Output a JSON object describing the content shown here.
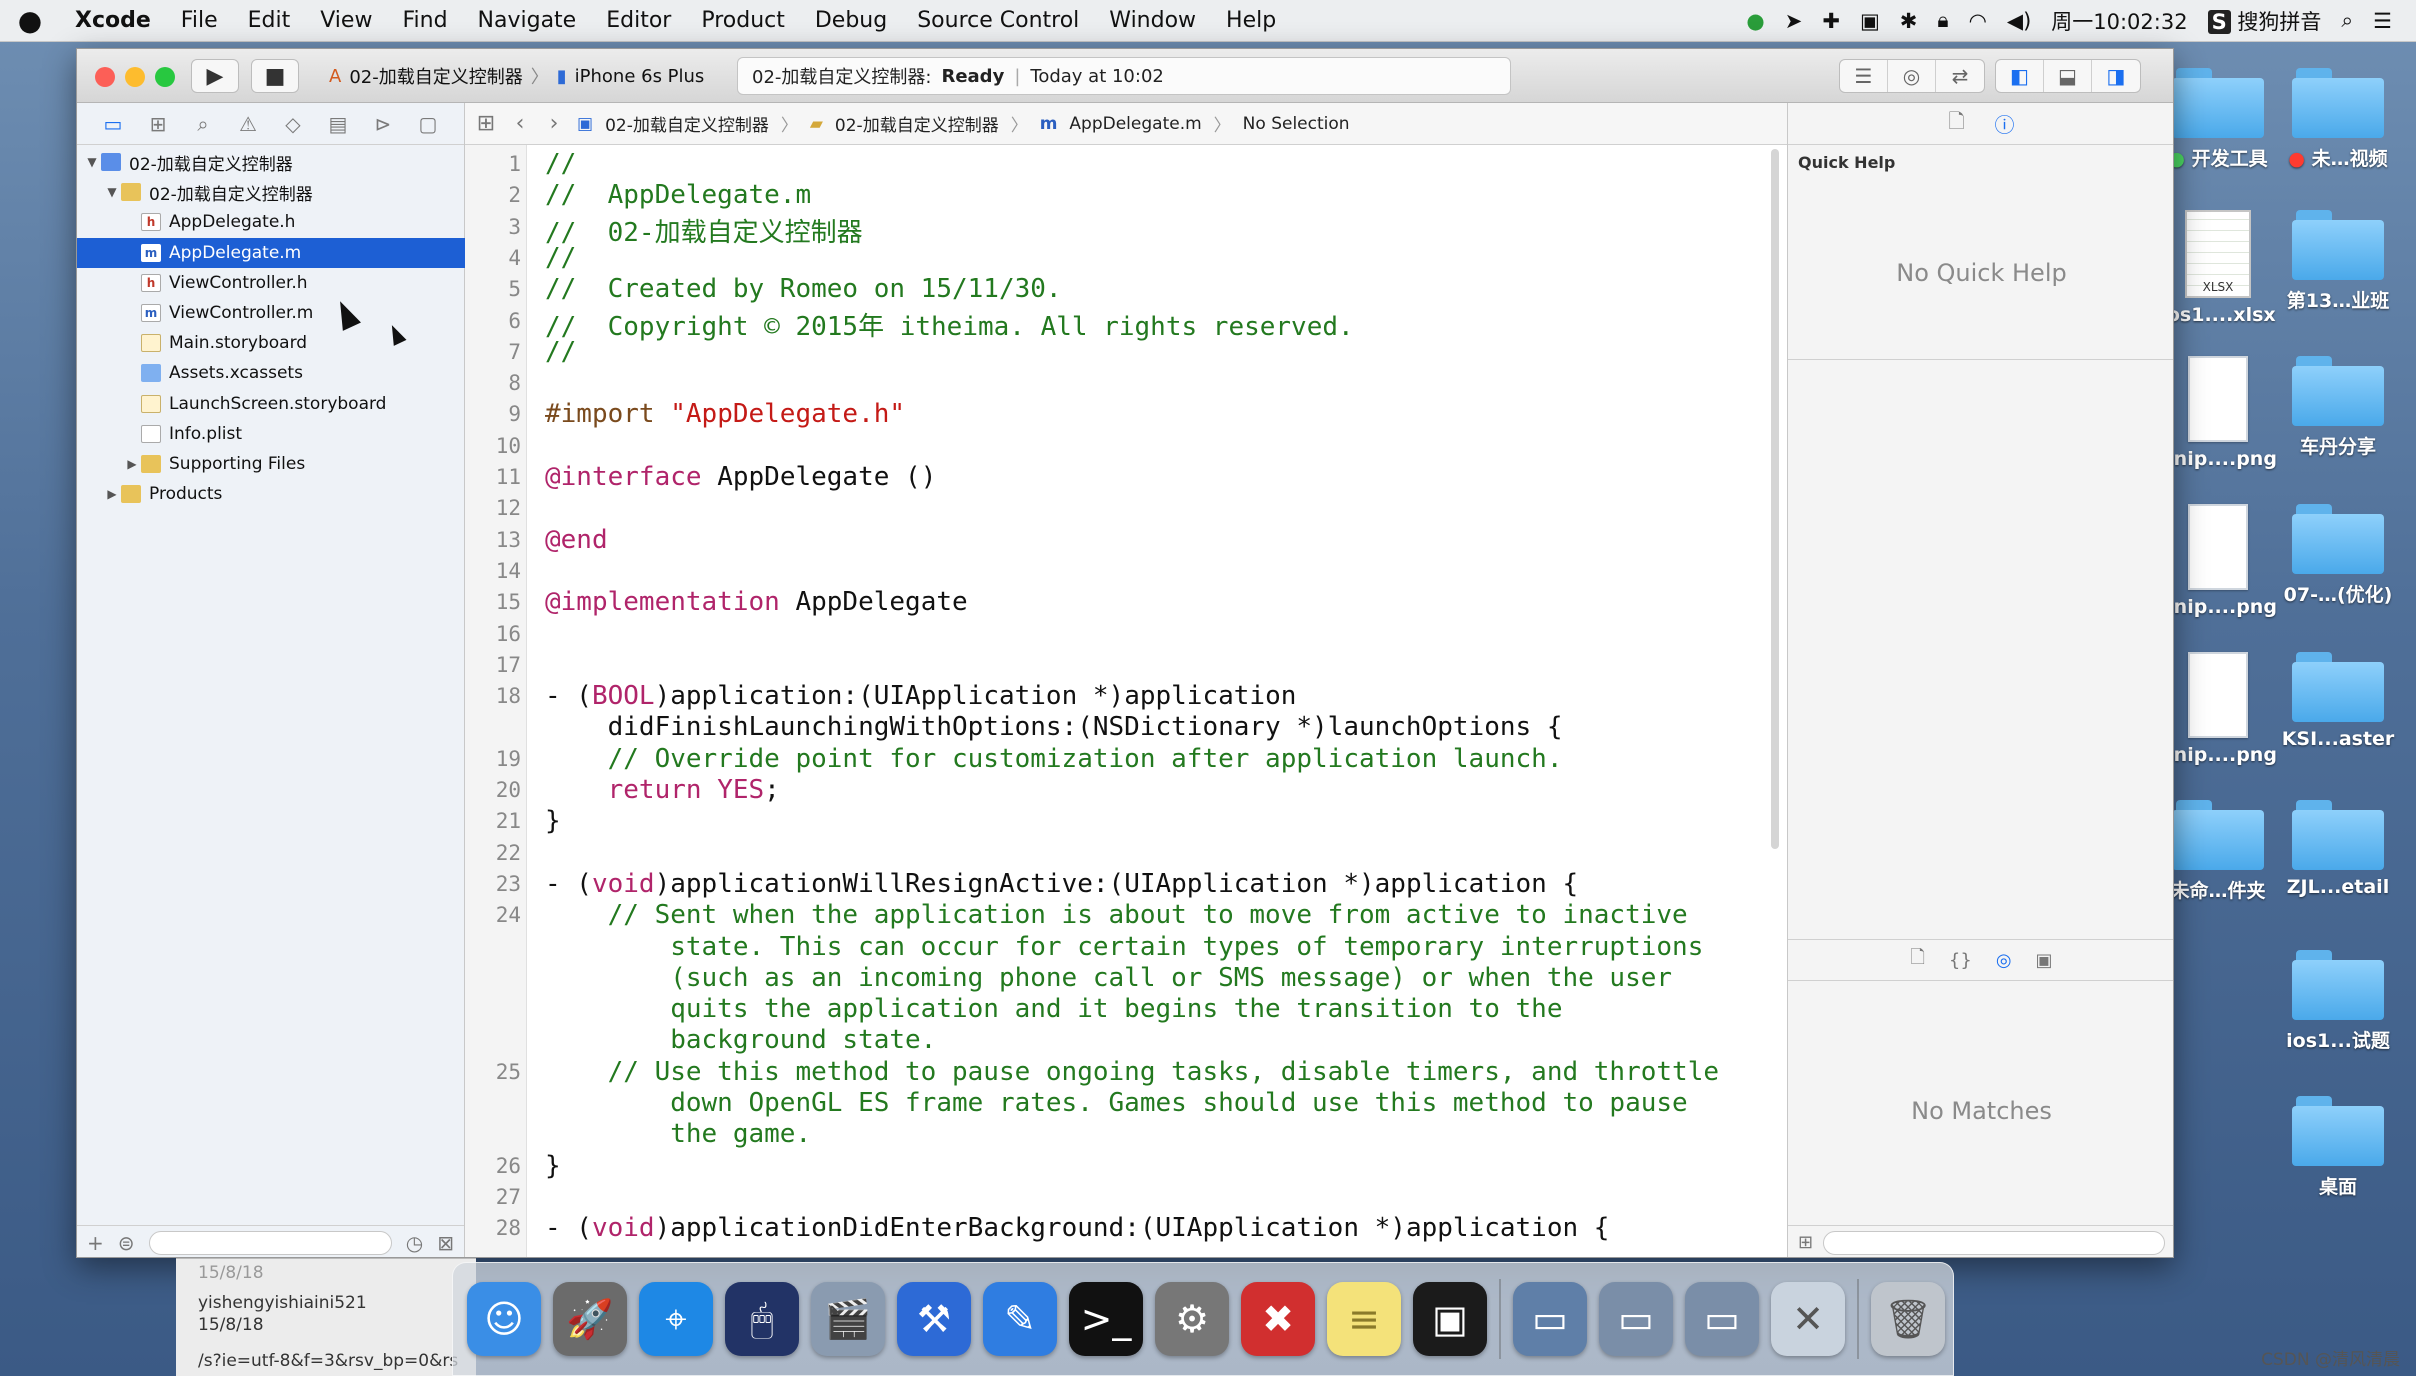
{
  "menubar": {
    "items": [
      "Xcode",
      "File",
      "Edit",
      "View",
      "Find",
      "Navigate",
      "Editor",
      "Product",
      "Debug",
      "Source Control",
      "Window",
      "Help"
    ],
    "clock": "周一10:02:32",
    "input_method": "搜狗拼音"
  },
  "toolbar": {
    "scheme": "02-加载自定义控制器",
    "device": "iPhone 6s Plus",
    "activity_project": "02-加载自定义控制器:",
    "activity_status": "Ready",
    "activity_time": "Today at 10:02"
  },
  "navigator": {
    "rows": [
      {
        "label": "02-加载自定义控制器",
        "icon": "project-icon",
        "indent": 0,
        "tri": "▼"
      },
      {
        "label": "02-加载自定义控制器",
        "icon": "folder-icon",
        "indent": 1,
        "tri": "▼"
      },
      {
        "label": "AppDelegate.h",
        "icon": "header-file-icon",
        "indent": 2,
        "tri": ""
      },
      {
        "label": "AppDelegate.m",
        "icon": "impl-file-icon",
        "indent": 2,
        "tri": "",
        "selected": true
      },
      {
        "label": "ViewController.h",
        "icon": "header-file-icon",
        "indent": 2,
        "tri": ""
      },
      {
        "label": "ViewController.m",
        "icon": "impl-file-icon",
        "indent": 2,
        "tri": ""
      },
      {
        "label": "Main.storyboard",
        "icon": "storyboard-icon",
        "indent": 2,
        "tri": ""
      },
      {
        "label": "Assets.xcassets",
        "icon": "assets-icon",
        "indent": 2,
        "tri": ""
      },
      {
        "label": "LaunchScreen.storyboard",
        "icon": "storyboard-icon",
        "indent": 2,
        "tri": ""
      },
      {
        "label": "Info.plist",
        "icon": "plist-icon",
        "indent": 2,
        "tri": ""
      },
      {
        "label": "Supporting Files",
        "icon": "folder-icon",
        "indent": 2,
        "tri": "▶"
      },
      {
        "label": "Products",
        "icon": "folder-icon",
        "indent": 1,
        "tri": "▶"
      }
    ]
  },
  "jumpbar": {
    "crumbs": [
      "02-加载自定义控制器",
      "02-加载自定义控制器",
      "AppDelegate.m",
      "No Selection"
    ]
  },
  "editor": {
    "lines": [
      {
        "n": "1",
        "segs": [
          [
            "comment",
            "//"
          ]
        ]
      },
      {
        "n": "2",
        "segs": [
          [
            "comment",
            "//  AppDelegate.m"
          ]
        ]
      },
      {
        "n": "3",
        "segs": [
          [
            "comment",
            "//  02-加载自定义控制器"
          ]
        ]
      },
      {
        "n": "4",
        "segs": [
          [
            "comment",
            "//"
          ]
        ]
      },
      {
        "n": "5",
        "segs": [
          [
            "comment",
            "//  Created by Romeo on 15/11/30."
          ]
        ]
      },
      {
        "n": "6",
        "segs": [
          [
            "comment",
            "//  Copyright © 2015年 itheima. All rights reserved."
          ]
        ]
      },
      {
        "n": "7",
        "segs": [
          [
            "comment",
            "//"
          ]
        ]
      },
      {
        "n": "8",
        "segs": []
      },
      {
        "n": "9",
        "segs": [
          [
            "pp",
            "#import "
          ],
          [
            "str",
            "\"AppDelegate.h\""
          ]
        ]
      },
      {
        "n": "10",
        "segs": []
      },
      {
        "n": "11",
        "segs": [
          [
            "kw",
            "@interface"
          ],
          [
            "plain",
            " AppDelegate ()"
          ]
        ]
      },
      {
        "n": "12",
        "segs": []
      },
      {
        "n": "13",
        "segs": [
          [
            "kw",
            "@end"
          ]
        ]
      },
      {
        "n": "14",
        "segs": []
      },
      {
        "n": "15",
        "segs": [
          [
            "kw",
            "@implementation"
          ],
          [
            "plain",
            " AppDelegate"
          ]
        ]
      },
      {
        "n": "16",
        "segs": []
      },
      {
        "n": "17",
        "segs": []
      },
      {
        "n": "18",
        "segs": [
          [
            "plain",
            "- ("
          ],
          [
            "kw",
            "BOOL"
          ],
          [
            "plain",
            ")application:(UIApplication *)application"
          ]
        ]
      },
      {
        "n": "",
        "segs": [
          [
            "plain",
            "    didFinishLaunchingWithOptions:(NSDictionary *)launchOptions {"
          ]
        ]
      },
      {
        "n": "19",
        "segs": [
          [
            "comment",
            "    // Override point for customization after application launch."
          ]
        ]
      },
      {
        "n": "20",
        "segs": [
          [
            "plain",
            "    "
          ],
          [
            "kw",
            "return"
          ],
          [
            "plain",
            " "
          ],
          [
            "kw",
            "YES"
          ],
          [
            "plain",
            ";"
          ]
        ]
      },
      {
        "n": "21",
        "segs": [
          [
            "plain",
            "}"
          ]
        ]
      },
      {
        "n": "22",
        "segs": []
      },
      {
        "n": "23",
        "segs": [
          [
            "plain",
            "- ("
          ],
          [
            "kw",
            "void"
          ],
          [
            "plain",
            ")applicationWillResignActive:(UIApplication *)application {"
          ]
        ]
      },
      {
        "n": "24",
        "segs": [
          [
            "comment",
            "    // Sent when the application is about to move from active to inactive"
          ]
        ]
      },
      {
        "n": "",
        "segs": [
          [
            "comment",
            "        state. This can occur for certain types of temporary interruptions"
          ]
        ]
      },
      {
        "n": "",
        "segs": [
          [
            "comment",
            "        (such as an incoming phone call or SMS message) or when the user"
          ]
        ]
      },
      {
        "n": "",
        "segs": [
          [
            "comment",
            "        quits the application and it begins the transition to the"
          ]
        ]
      },
      {
        "n": "",
        "segs": [
          [
            "comment",
            "        background state."
          ]
        ]
      },
      {
        "n": "25",
        "segs": [
          [
            "comment",
            "    // Use this method to pause ongoing tasks, disable timers, and throttle"
          ]
        ]
      },
      {
        "n": "",
        "segs": [
          [
            "comment",
            "        down OpenGL ES frame rates. Games should use this method to pause"
          ]
        ]
      },
      {
        "n": "",
        "segs": [
          [
            "comment",
            "        the game."
          ]
        ]
      },
      {
        "n": "26",
        "segs": [
          [
            "plain",
            "}"
          ]
        ]
      },
      {
        "n": "27",
        "segs": []
      },
      {
        "n": "28",
        "segs": [
          [
            "plain",
            "- ("
          ],
          [
            "kw",
            "void"
          ],
          [
            "plain",
            ")applicationDidEnterBackground:(UIApplication *)application {"
          ]
        ]
      }
    ]
  },
  "utilities": {
    "quick_help_title": "Quick Help",
    "quick_help_empty": "No Quick Help",
    "library_empty": "No Matches"
  },
  "desktop": {
    "icons": [
      {
        "label": "开发工具",
        "kind": "folder",
        "dot": "#4cd964"
      },
      {
        "label": "未…视频",
        "kind": "folder",
        "dot": "#ff3b30"
      },
      {
        "label": "ios1....xlsx",
        "kind": "xlsx"
      },
      {
        "label": "第13…业班",
        "kind": "folder"
      },
      {
        "label": "Snip....png",
        "kind": "doc"
      },
      {
        "label": "车丹分享",
        "kind": "folder"
      },
      {
        "label": "Snip....png",
        "kind": "doc"
      },
      {
        "label": "07-…(优化)",
        "kind": "folder"
      },
      {
        "label": "Snip....png",
        "kind": "doc"
      },
      {
        "label": "KSI...aster",
        "kind": "folder"
      },
      {
        "label": "未命…件夹",
        "kind": "folder"
      },
      {
        "label": "ZJL...etail",
        "kind": "folder"
      },
      {
        "label": "ios1...试题",
        "kind": "folder"
      },
      {
        "label": "桌面",
        "kind": "folder"
      }
    ],
    "xlsx_badge": "XLSX"
  },
  "background_window": {
    "line1": "15/8/18",
    "line2": "yishengyishiaini521",
    "line3": "15/8/18",
    "line4": "/s?ie=utf-8&f=3&rsv_bp=0&rs"
  },
  "dock": {
    "apps": [
      {
        "name": "finder",
        "color": "#3a8ee6",
        "glyph": "☺"
      },
      {
        "name": "launchpad",
        "color": "#6b6b6b",
        "glyph": "🚀"
      },
      {
        "name": "safari",
        "color": "#1e88e5",
        "glyph": "⌖"
      },
      {
        "name": "mouse",
        "color": "#223366",
        "glyph": "🖱"
      },
      {
        "name": "photo-app",
        "color": "#8a9bb0",
        "glyph": "🎬"
      },
      {
        "name": "xcode",
        "color": "#2d6ad6",
        "glyph": "⚒"
      },
      {
        "name": "app-developer",
        "color": "#2f7de1",
        "glyph": "✎"
      },
      {
        "name": "terminal",
        "color": "#111111",
        "glyph": ">_"
      },
      {
        "name": "system-preferences",
        "color": "#777777",
        "glyph": "⚙"
      },
      {
        "name": "xmind",
        "color": "#d12f2f",
        "glyph": "✖"
      },
      {
        "name": "notes",
        "color": "#f4e27a",
        "glyph": "≡"
      },
      {
        "name": "console",
        "color": "#1b1b1b",
        "glyph": "▣"
      },
      {
        "name": "screen-share-1",
        "color": "#5f7fa8",
        "glyph": "▭"
      },
      {
        "name": "screen-share-2",
        "color": "#7a8ea8",
        "glyph": "▭"
      },
      {
        "name": "screen-share-3",
        "color": "#7a8ea8",
        "glyph": "▭"
      },
      {
        "name": "document-x",
        "color": "#c9d3de",
        "glyph": "✕"
      },
      {
        "name": "trash",
        "color": "#bfc5cc",
        "glyph": "🗑"
      }
    ]
  },
  "watermark": "CSDN @清风清晨"
}
